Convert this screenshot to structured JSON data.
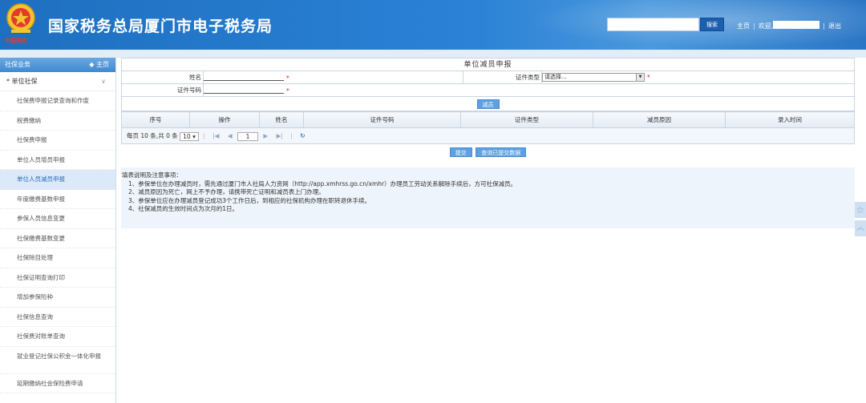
{
  "header": {
    "title": "国家税务总局厦门市电子税务局",
    "emblem_text": "中国税务",
    "search_button": "搜索",
    "links": {
      "home": "主页",
      "welcome": "欢迎,",
      "logout": "退出"
    },
    "colors": {
      "header_blue": "#2b82d6",
      "emblem_red": "#e23b2e"
    }
  },
  "sidebar": {
    "section": "社保业务",
    "home_link": "主页",
    "group": "单位社保",
    "items": [
      {
        "label": "社保费申报记录查询和作废"
      },
      {
        "label": "税费缴纳"
      },
      {
        "label": "社保费申报"
      },
      {
        "label": "单位人员增员申报"
      },
      {
        "label": "单位人员减员申报",
        "active": true
      },
      {
        "label": "年度缴费基数申报"
      },
      {
        "label": "参保人员信息变更"
      },
      {
        "label": "社保缴费基数变更"
      },
      {
        "label": "社保除目处理"
      },
      {
        "label": "社保证明查询打印"
      },
      {
        "label": "增加参保险种"
      },
      {
        "label": "社保信息查询"
      },
      {
        "label": "社保费对账单查询"
      },
      {
        "label": "就业登记社保公积金一体化申报"
      },
      {
        "label": "延期缴纳社会保险费申请"
      }
    ]
  },
  "form": {
    "title": "单位减员申报",
    "name_label": "姓名",
    "id_type_label": "证件类型",
    "id_type_value": "请选择...",
    "id_no_label": "证件号码",
    "required_mark": "*",
    "reduce_button": "减员"
  },
  "grid": {
    "columns": [
      "序号",
      "操作",
      "姓名",
      "证件号码",
      "证件类型",
      "减员原因",
      "录入时间"
    ],
    "rows": []
  },
  "pager": {
    "summary": "每页 10 条,共 0 条",
    "page_size": "10",
    "page": "1",
    "first": "|◀",
    "prev": "◀",
    "next": "▶",
    "last": "▶|",
    "refresh": "↻"
  },
  "actions": {
    "submit": "提交",
    "query_submitted": "查询已提交数据"
  },
  "notes": {
    "heading": "填表说明及注意事项：",
    "lines": [
      "1、参保单位在办理减员时，需先通过厦门市人社局人力资网（http://app.xmhrss.go.cn/xmhr）办理员工劳动关系解除手续后，方可社保减员。",
      "2、减员原因为死亡，网上不予办理，请携带死亡证明和减员表上门办理。",
      "3、参保单位应在办理减员登记成功3个工作日后，到相应的社保机构办理在职转退休手续。",
      "4、社保减员的生效时间点为次月的1日。"
    ]
  }
}
